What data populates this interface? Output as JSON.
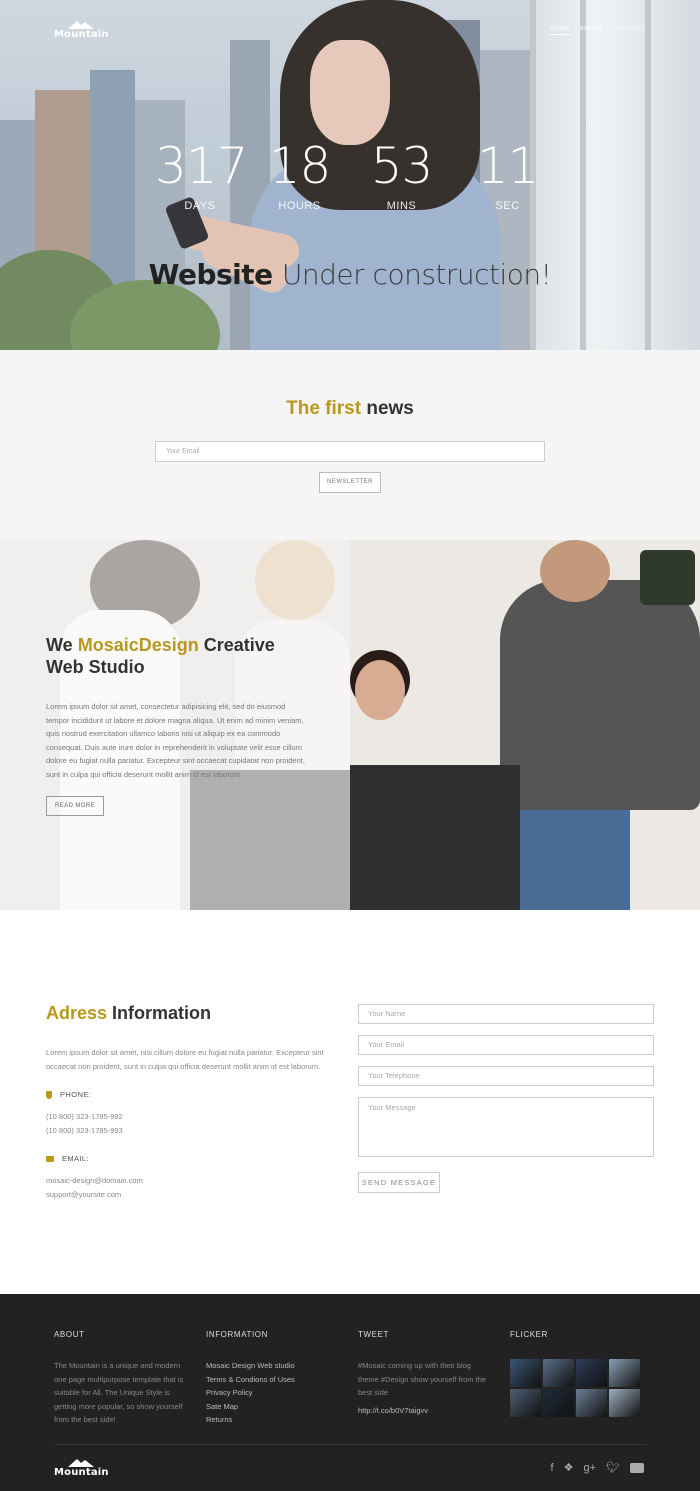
{
  "brand": {
    "name": "Mountain"
  },
  "nav": {
    "items": [
      "HOME",
      "ABOUT",
      "CONTACT"
    ]
  },
  "hero": {
    "countdown": [
      {
        "value": "317",
        "label": "DAYS"
      },
      {
        "value": "18",
        "label": "HOURS"
      },
      {
        "value": "53",
        "label": "MINS"
      },
      {
        "value": "11",
        "label": "SEC"
      }
    ],
    "title_bold": "Website",
    "title_light": "Under construction!"
  },
  "newsletter": {
    "title_gold": "The first",
    "title_rest": "news",
    "email_placeholder": "Your Email",
    "button": "NEWSLETTER"
  },
  "studio": {
    "title_pre": "We",
    "title_gold": "MosaicDesign",
    "title_post": "Creative",
    "title_line2": "Web Studio",
    "text": "Lorem ipsum dolor sit amet, consectetur adipisicing elit, sed do eiusmod tempor incididunt ut labore et dolore magna aliqua. Ut enim ad minim veniam, quis nostrud exercitation ullamco laboris nisi ut aliquip ex ea commodo consequat. Duis aute irure dolor in reprehenderit in voluptate velit esse cillum dolore eu fugiat nulla pariatur. Excepteur sint occaecat cupidatat non proident, sunt in culpa qui officia deserunt mollit anim id est laborum.",
    "button": "READ MORE"
  },
  "contact": {
    "title_gold": "Adress",
    "title_rest": "Information",
    "intro": "Lorem ipsum dolor sit amet, nisi cillum dolore eu fugiat nulla pariatur. Excepteur sint occaecat non proident, sunt in culpa qui officia deserunt mollit anim id est laborum.",
    "phone_label": "PHONE:",
    "phones": [
      "(10 800) 323-1785-992",
      "(10 800) 323-1785-993"
    ],
    "email_label": "EMAIL:",
    "emails": [
      "mosaic-design@domain.com",
      "support@yoursite.com"
    ],
    "form": {
      "name_placeholder": "Your Name",
      "email_placeholder": "Your Email",
      "phone_placeholder": "Your Telephone",
      "message_placeholder": "Your Message",
      "button": "SEND MESSAGE"
    }
  },
  "footer": {
    "about_title": "ABOUT",
    "about_text": "The Mountain is a unique and modern one page multipurpose template that is suitable for All. The Unique Style is getting more popular, so show yourself from the best side!",
    "info_title": "INFORMATION",
    "info_links": [
      "Mosaic Design Web studio",
      "Terms & Condions of Uses",
      "Privacy Policy",
      "Sate Map",
      "Returns"
    ],
    "tweet_title": "TWEET",
    "tweet_text": "#Mosaic coming up with their blog theme #Design show yourself from the best side",
    "tweet_link": "http://t.co/b0V7taigvv",
    "flickr_title": "FLICKER",
    "flickr_colors": [
      "#3b5573",
      "#5a6f8b",
      "#2e3d5a",
      "#8aa1b7",
      "#4d5f73",
      "#1f2c3b",
      "#6c7f96",
      "#9db0c2"
    ],
    "social_icons": [
      "facebook-icon",
      "dropbox-icon",
      "google-plus-icon",
      "twitter-icon",
      "youtube-icon"
    ]
  }
}
